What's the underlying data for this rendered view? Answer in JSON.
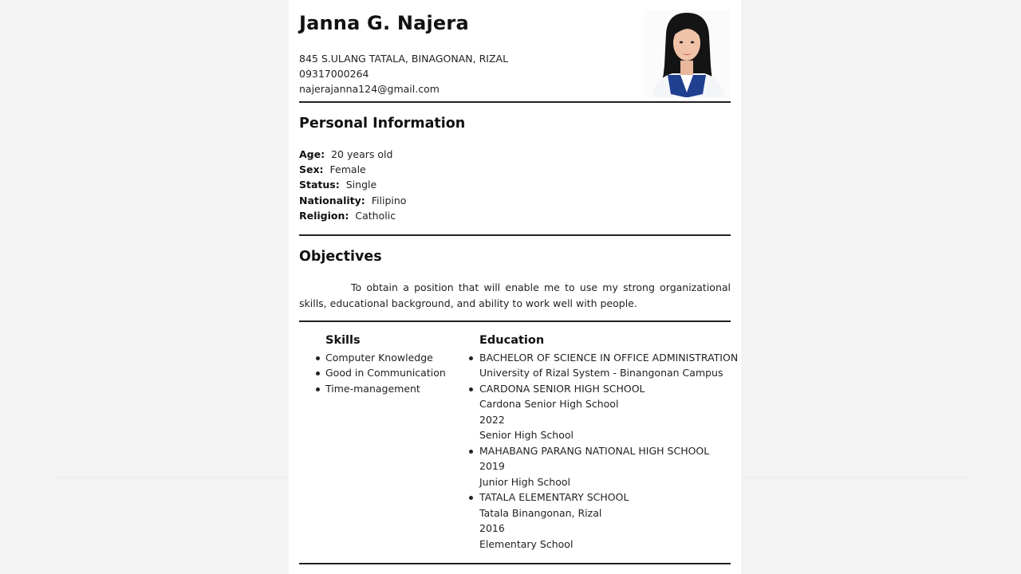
{
  "resume": {
    "name": "Janna G. Najera",
    "address": "845 S.ULANG TATALA, BINAGONAN, RIZAL",
    "phone": "09317000264",
    "email": "najerajanna124@gmail.com"
  },
  "personal_information": {
    "title": "Personal Information",
    "rows": [
      {
        "label": "Age:",
        "value": "20 years old"
      },
      {
        "label": "Sex:",
        "value": "Female"
      },
      {
        "label": "Status:",
        "value": "Single"
      },
      {
        "label": "Nationality:",
        "value": "Filipino"
      },
      {
        "label": "Religion:",
        "value": "Catholic"
      }
    ]
  },
  "objectives": {
    "title": "Objectives",
    "text": "To obtain a position that will enable me to use my strong organizational skills, educational background, and ability to work well with people."
  },
  "skills": {
    "title": "Skills",
    "items": [
      "Computer Knowledge",
      "Good in Communication",
      "Time-management"
    ]
  },
  "education": {
    "title": "Education",
    "items": [
      {
        "lines": [
          "BACHELOR OF SCIENCE IN OFFICE ADMINISTRATION",
          "University of Rizal System - Binangonan Campus"
        ]
      },
      {
        "lines": [
          "CARDONA SENIOR HIGH SCHOOL",
          "Cardona Senior High School",
          "2022",
          "Senior High School"
        ]
      },
      {
        "lines": [
          "MAHABANG PARANG NATIONAL HIGH SCHOOL",
          "2019",
          "Junior High School"
        ]
      },
      {
        "lines": [
          "TATALA ELEMENTARY SCHOOL",
          "Tatala Binangonan, Rizal",
          "2016",
          "Elementary School"
        ]
      }
    ]
  },
  "colors": {
    "page": "#ffffff",
    "background": "#f3f3f4",
    "text": "#1a1a1a",
    "rule": "#222222",
    "uniform": "#1f3f8f",
    "hair": "#121212"
  }
}
